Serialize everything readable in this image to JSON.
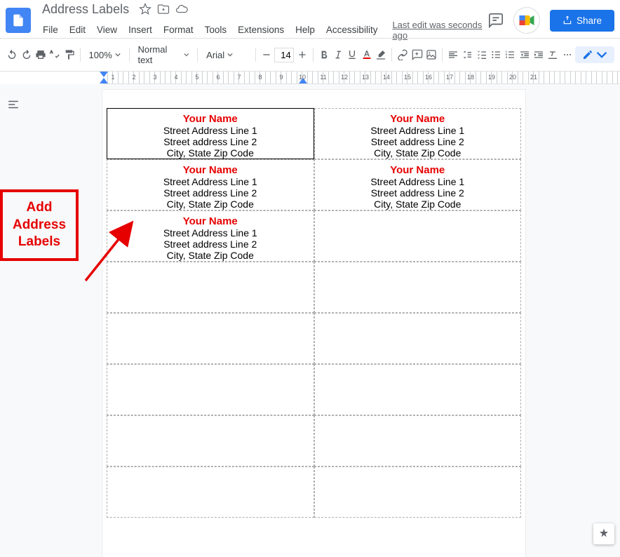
{
  "header": {
    "title": "Address Labels",
    "last_edit": "Last edit was seconds ago",
    "share_label": "Share"
  },
  "menu": {
    "items": [
      "File",
      "Edit",
      "View",
      "Insert",
      "Format",
      "Tools",
      "Extensions",
      "Help",
      "Accessibility"
    ]
  },
  "toolbar": {
    "zoom": "100%",
    "style": "Normal text",
    "font": "Arial",
    "font_size": "14"
  },
  "ruler": {
    "ticks": [
      1,
      2,
      3,
      4,
      5,
      6,
      7,
      8,
      9,
      10,
      11,
      12,
      13,
      14,
      15,
      16,
      17,
      18,
      19,
      20,
      21
    ]
  },
  "annotation": {
    "line1": "Add",
    "line2": "Address",
    "line3": "Labels"
  },
  "labels": {
    "rows": [
      [
        {
          "name": "Your Name",
          "addr1": "Street Address Line 1",
          "addr2": "Street address Line 2",
          "city": "City, State Zip Code",
          "selected": true
        },
        {
          "name": "Your Name",
          "addr1": "Street Address Line 1",
          "addr2": "Street address Line 2",
          "city": "City, State Zip Code"
        }
      ],
      [
        {
          "name": "Your Name",
          "addr1": "Street Address Line 1",
          "addr2": "Street address Line 2",
          "city": "City, State Zip Code"
        },
        {
          "name": "Your Name",
          "addr1": "Street Address Line 1",
          "addr2": "Street address Line 2",
          "city": "City, State Zip Code"
        }
      ],
      [
        {
          "name": "Your Name",
          "addr1": "Street Address Line 1",
          "addr2": "Street address Line 2",
          "city": "City, State Zip Code"
        },
        {
          "empty": true
        }
      ],
      [
        {
          "empty": true
        },
        {
          "empty": true
        }
      ],
      [
        {
          "empty": true
        },
        {
          "empty": true
        }
      ],
      [
        {
          "empty": true
        },
        {
          "empty": true
        }
      ],
      [
        {
          "empty": true
        },
        {
          "empty": true
        }
      ],
      [
        {
          "empty": true
        },
        {
          "empty": true
        }
      ]
    ]
  }
}
